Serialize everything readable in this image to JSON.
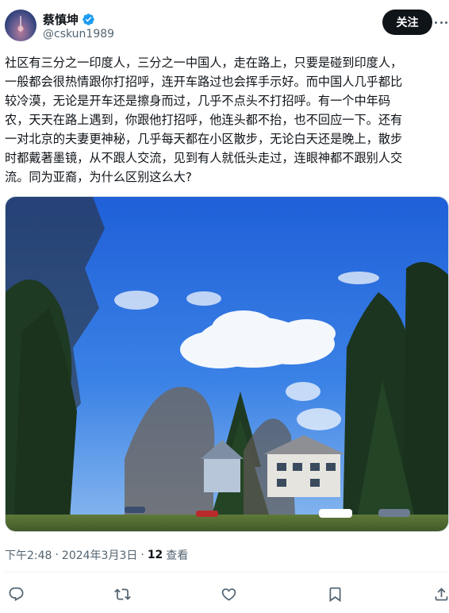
{
  "author": {
    "display_name": "蔡慎坤",
    "handle": "@cskun1989",
    "verified": true,
    "avatar_icon": "avatar-night-sky"
  },
  "follow_label": "关注",
  "more_icon": "more-dots-icon",
  "tweet": {
    "lines": [
      "社区有三分之一印度人，三分之一中国人，走在路上，只要是碰到印度人，",
      "一般都会很热情跟你打招呼，连开车路过也会挥手示好。而中国人几乎都比",
      "较冷漠，无论是开车还是擦身而过，几乎不点头不打招呼。有一个中年码",
      "农，天天在路上遇到，你跟他打招呼，他连头都不抬，也不回应一下。还有",
      "一对北京的夫妻更神秘，几乎每天都在小区散步，无论白天还是晚上，散步",
      "时都戴著墨镜，从不跟人交流，见到有人就低头走过，连眼神都不跟别人交",
      "流。同为亚裔，为什么区别这么大?"
    ]
  },
  "photo": {
    "subject": "blue sky with clouds over residential neighborhood with tall trees and houses"
  },
  "meta": {
    "time": "下午2:48",
    "separator1": "·",
    "date": "2024年3月3日",
    "separator2": "·",
    "views_count": "12",
    "views_label": "查看"
  },
  "actions": {
    "reply_icon": "reply-icon",
    "retweet_icon": "retweet-icon",
    "like_icon": "heart-icon",
    "bookmark_icon": "bookmark-icon",
    "share_icon": "share-icon"
  },
  "colors": {
    "text_primary": "#0f1419",
    "text_secondary": "#536471",
    "verified_blue": "#1d9bf0",
    "follow_bg": "#0f1419"
  }
}
